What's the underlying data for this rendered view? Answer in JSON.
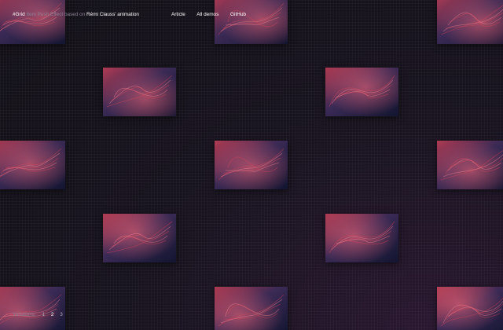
{
  "header": {
    "title_hash": "#Grid",
    "title_mid": "Item Push Effect based on",
    "title_link": "Rémi Clauss' animation",
    "nav": [
      "Article",
      "All demos",
      "GitHub"
    ]
  },
  "variations": {
    "label": "Variations:",
    "options": [
      "1",
      "2",
      "3"
    ],
    "active": "2"
  },
  "colors": {
    "background": "#161219",
    "accent_red": "#e0445a",
    "accent_blue": "#2a3060",
    "text": "#ffffff"
  },
  "gallery": {
    "rows": 5,
    "cols": 5,
    "item_count": 15
  }
}
